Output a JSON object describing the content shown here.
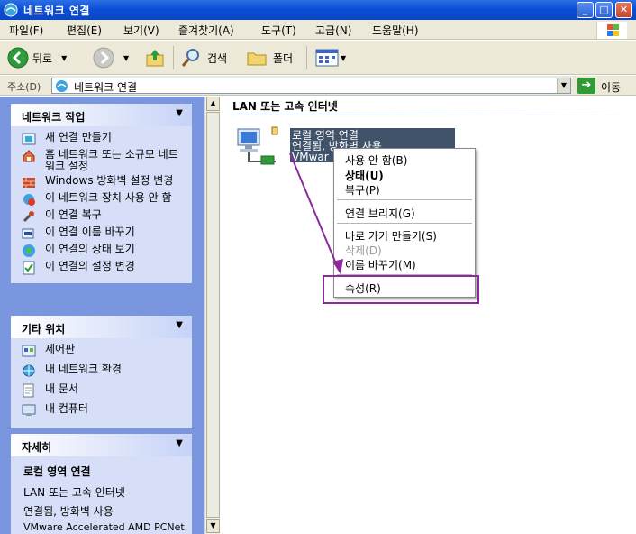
{
  "window": {
    "title": "네트워크 연결",
    "minimize": "_",
    "maximize": "□",
    "close": "✕"
  },
  "menu": [
    {
      "label": "파일(F)"
    },
    {
      "label": "편집(E)"
    },
    {
      "label": "보기(V)"
    },
    {
      "label": "즐겨찾기(A)"
    },
    {
      "label": "도구(T)"
    },
    {
      "label": "고급(N)"
    },
    {
      "label": "도움말(H)"
    }
  ],
  "toolbar": {
    "back_label": "뒤로",
    "search_label": "검색",
    "folders_label": "폴더"
  },
  "address": {
    "label": "주소(D)",
    "value": "네트워크 연결",
    "go_label": "이동"
  },
  "left": {
    "network_tasks": {
      "title": "네트워크 작업",
      "items": [
        {
          "label": "새 연결 만들기",
          "icon": "new-connection-icon"
        },
        {
          "label": "홈 네트워크 또는 소규모 네트워크 설정",
          "icon": "home-network-icon"
        },
        {
          "label": "Windows 방화벽 설정 변경",
          "icon": "firewall-icon"
        },
        {
          "label": "이 네트워크 장치 사용 안 함",
          "icon": "disable-device-icon"
        },
        {
          "label": "이 연결 복구",
          "icon": "repair-icon"
        },
        {
          "label": "이 연결 이름 바꾸기",
          "icon": "rename-icon"
        },
        {
          "label": "이 연결의 상태 보기",
          "icon": "status-icon"
        },
        {
          "label": "이 연결의 설정 변경",
          "icon": "settings-icon"
        }
      ]
    },
    "other_places": {
      "title": "기타 위치",
      "items": [
        {
          "label": "제어판",
          "icon": "control-panel-icon"
        },
        {
          "label": "내 네트워크 환경",
          "icon": "my-network-icon"
        },
        {
          "label": "내 문서",
          "icon": "my-documents-icon"
        },
        {
          "label": "내 컴퓨터",
          "icon": "my-computer-icon"
        }
      ]
    },
    "details": {
      "title": "자세히",
      "name": "로컬 영역 연결",
      "type": "LAN 또는 고속 인터넷",
      "status": "연결됨, 방화벽 사용",
      "device": "VMware Accelerated AMD PCNet Adapter"
    }
  },
  "content": {
    "group_title": "LAN 또는 고속 인터넷",
    "connection": {
      "name": "로컬 영역 연결",
      "status": "연결됨, 방화벽 사용",
      "device": "VMwar"
    }
  },
  "context_menu": {
    "items": [
      {
        "label": "사용 안 함(B)"
      },
      {
        "label": "상태(U)"
      },
      {
        "label": "복구(P)"
      },
      {
        "label": "연결 브리지(G)"
      },
      {
        "label": "바로 가기 만들기(S)"
      },
      {
        "label": "삭제(D)"
      },
      {
        "label": "이름 바꾸기(M)"
      },
      {
        "label": "속성(R)"
      }
    ]
  },
  "colors": {
    "titlebar": "#0b4fd6",
    "taskpane": "#7a96df",
    "annotation": "#8b2a9c"
  }
}
